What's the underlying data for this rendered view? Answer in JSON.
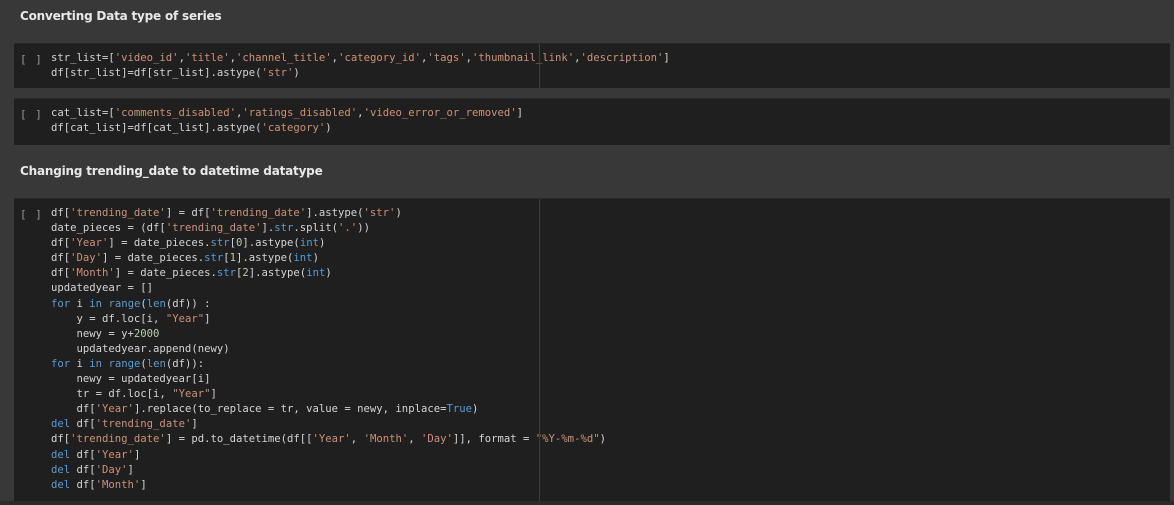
{
  "headings": {
    "h1": "Converting Data type of series",
    "h2": "Changing trending_date to datetime datatype"
  },
  "run_button_label": "[ ]",
  "cell1": {
    "lines": [
      "str_list=['video_id','title','channel_title','category_id','tags','thumbnail_link','description']",
      "df[str_list]=df[str_list].astype('str')"
    ]
  },
  "cell2": {
    "lines": [
      "cat_list=['comments_disabled','ratings_disabled','video_error_or_removed']",
      "df[cat_list]=df[cat_list].astype('category')"
    ]
  },
  "cell3": {
    "lines": [
      "df['trending_date'] = df['trending_date'].astype('str')",
      "date_pieces = (df['trending_date'].str.split('.'))",
      "df['Year'] = date_pieces.str[0].astype(int)",
      "df['Day'] = date_pieces.str[1].astype(int)",
      "df['Month'] = date_pieces.str[2].astype(int)",
      "updatedyear = []",
      "for i in range(len(df)) :",
      "    y = df.loc[i, \"Year\"]",
      "    newy = y+2000",
      "    updatedyear.append(newy)",
      "for i in range(len(df)):",
      "    newy = updatedyear[i]",
      "    tr = df.loc[i, \"Year\"]",
      "    df['Year'].replace(to_replace = tr, value = newy, inplace=True)",
      "del df['trending_date']",
      "df['trending_date'] = pd.to_datetime(df[['Year', 'Month', 'Day']], format = \"%Y-%m-%d\")",
      "del df['Year']",
      "del df['Day']",
      "del df['Month']"
    ]
  }
}
